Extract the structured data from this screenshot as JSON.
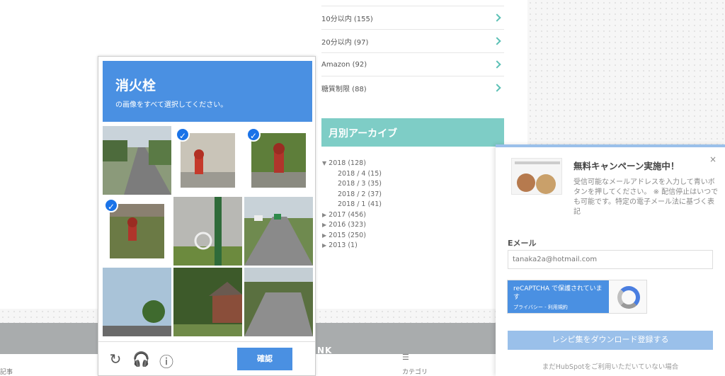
{
  "categories": [
    {
      "label": "10分以内 (155)"
    },
    {
      "label": "20分以内 (97)"
    },
    {
      "label": "Amazon (92)"
    },
    {
      "label": "糖質制限 (88)"
    }
  ],
  "archive": {
    "heading": "月別アーカイブ",
    "items": [
      {
        "label": "2018 (128)",
        "expanded": true
      },
      {
        "label": "2018 / 4 (15)",
        "sub": true
      },
      {
        "label": "2018 / 3 (35)",
        "sub": true
      },
      {
        "label": "2018 / 2 (37)",
        "sub": true
      },
      {
        "label": "2018 / 1 (41)",
        "sub": true
      },
      {
        "label": "2017 (456)"
      },
      {
        "label": "2016 (323)"
      },
      {
        "label": "2015 (250)"
      },
      {
        "label": "2013 (1)"
      }
    ]
  },
  "captcha": {
    "title": "消火栓",
    "subtitle": "の画像をすべて選択してください。",
    "verify_label": "確認",
    "tiles": [
      {
        "selected": false,
        "scene": "road"
      },
      {
        "selected": true,
        "scene": "hydrant"
      },
      {
        "selected": true,
        "scene": "hydrant-grass"
      },
      {
        "selected": true,
        "scene": "hydrant-grass"
      },
      {
        "selected": false,
        "scene": "bike-pole"
      },
      {
        "selected": false,
        "scene": "road-trucks"
      },
      {
        "selected": false,
        "scene": "sky-trees"
      },
      {
        "selected": false,
        "scene": "house-trees"
      },
      {
        "selected": false,
        "scene": "road-trees"
      }
    ]
  },
  "footer": {
    "left_label": "記事",
    "center_label": "カテゴリ",
    "band_text": "NK"
  },
  "popup": {
    "title": "無料キャンペーン実施中！",
    "close": "×",
    "desc": "受信可能なメールアドレスを入力して青いボタンを押してください。 ※ 配信停止はいつでも可能です。特定の電子メール法に基づく表記",
    "email_label": "Eメール",
    "email_value": "tanaka2a@hotmail.com",
    "recaptcha_text": "reCAPTCHA で保護されています",
    "recaptcha_links": "プライバシー - 利用規約",
    "submit_label": "レシピ集をダウンロード登録する",
    "footer_text": "まだHubSpotをご利用いただいていない場合"
  },
  "colors": {
    "captcha_blue": "#4a90e2",
    "teal": "#7ecdc6",
    "popup_button": "#9ac0ea"
  }
}
